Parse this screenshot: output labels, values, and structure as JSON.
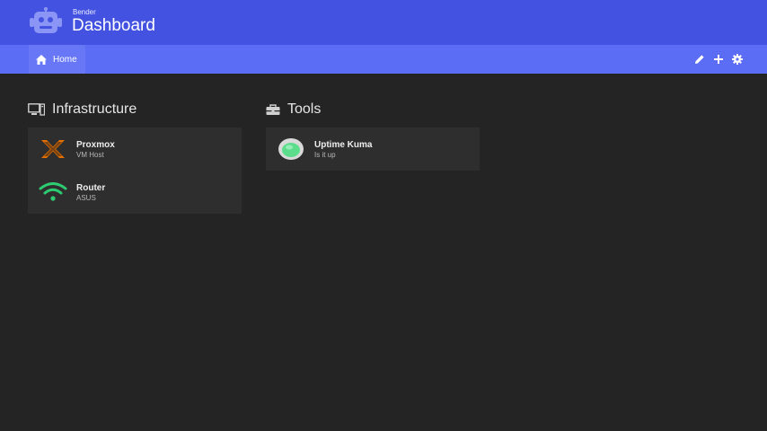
{
  "header": {
    "subtitle": "Bender",
    "title": "Dashboard",
    "logo_icon": "robot-icon",
    "background": "#4352e0"
  },
  "nav": {
    "home_label": "Home",
    "home_icon": "home-icon",
    "actions": [
      "edit-icon",
      "add-icon",
      "gear-icon"
    ],
    "background": "#5b6cf5"
  },
  "groups": [
    {
      "title": "Infrastructure",
      "icon": "server-icon",
      "items": [
        {
          "name": "Proxmox",
          "description": "VM Host",
          "icon": "proxmox-icon",
          "color": "#e57000"
        },
        {
          "name": "Router",
          "description": "ASUS",
          "icon": "wifi-icon",
          "color": "#2ecc71"
        }
      ]
    },
    {
      "title": "Tools",
      "icon": "toolbox-icon",
      "items": [
        {
          "name": "Uptime Kuma",
          "description": "Is it up",
          "icon": "uptime-kuma-icon",
          "color": "#5cdd8b"
        }
      ]
    }
  ]
}
